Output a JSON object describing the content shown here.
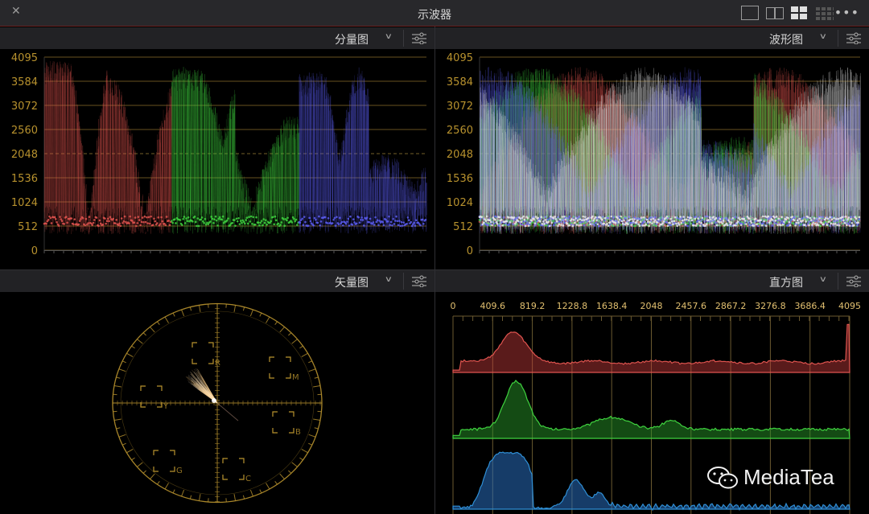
{
  "window": {
    "title": "示波器"
  },
  "toolbar": {
    "close_icon": "close-icon",
    "layouts": [
      "single",
      "two-up",
      "quad",
      "grid"
    ],
    "active_layout": "quad",
    "menu_icon": "more-icon"
  },
  "panels": {
    "parade": {
      "label": "分量图",
      "y_ticks": [
        "4095",
        "3584",
        "3072",
        "2560",
        "2048",
        "1536",
        "1024",
        "512",
        "0"
      ]
    },
    "waveform": {
      "label": "波形图",
      "y_ticks": [
        "4095",
        "3584",
        "3072",
        "2560",
        "2048",
        "1536",
        "1024",
        "512",
        "0"
      ]
    },
    "vectorscope": {
      "label": "矢量图",
      "targets": [
        "R",
        "M",
        "B",
        "C",
        "G",
        "Y"
      ]
    },
    "histogram": {
      "label": "直方图",
      "x_ticks": [
        "0",
        "409.6",
        "819.2",
        "1228.8",
        "1638.4",
        "2048",
        "2457.6",
        "2867.2",
        "3276.8",
        "3686.4",
        "4095"
      ]
    }
  },
  "watermark": {
    "text": "MediaTea"
  },
  "colors": {
    "red": "#e0544f",
    "green": "#3fd33f",
    "blue": "#5a5cf0",
    "gold": "#b8922e",
    "hist_blue": "#2f8fd6"
  }
}
